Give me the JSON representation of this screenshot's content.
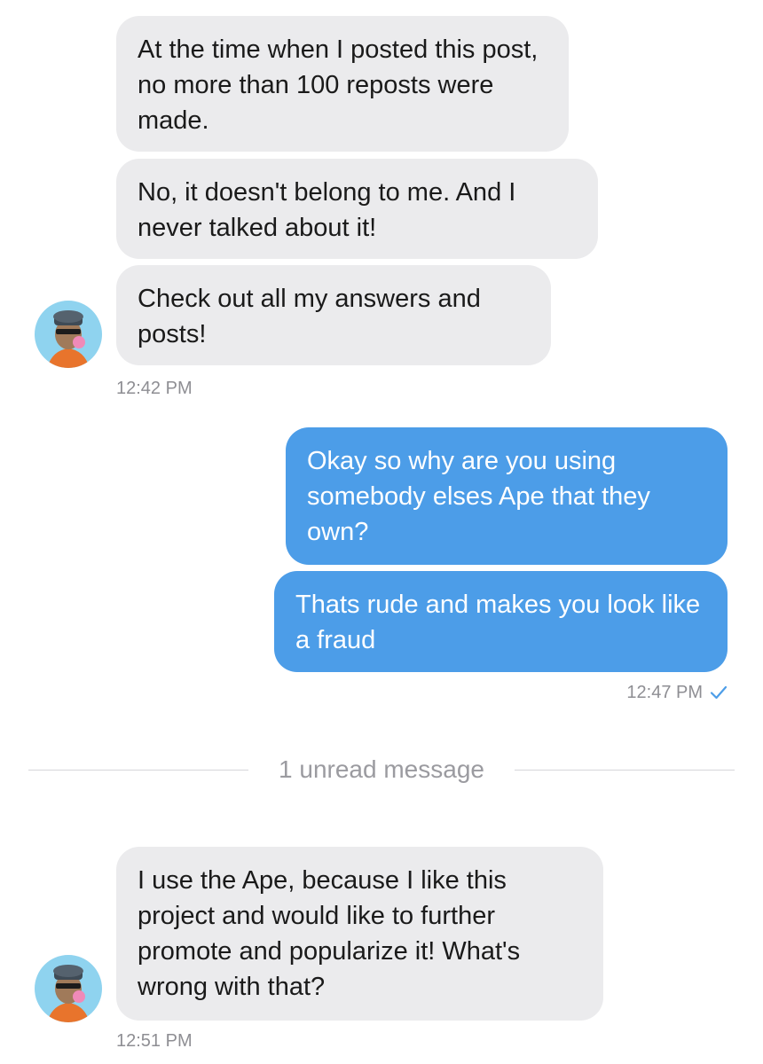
{
  "thread": {
    "first_group": {
      "messages": [
        "At the time when I posted this post, no more than 100 reposts were made.",
        "No, it doesn't belong to me. And I never talked about it!",
        "Check out all my answers and posts!"
      ],
      "time": "12:42 PM",
      "avatar": "ape-avatar-icon"
    },
    "my_group": {
      "messages": [
        "Okay so why are you using somebody elses Ape that they own?",
        "Thats rude and makes you look like a fraud"
      ],
      "time": "12:47 PM",
      "status_icon": "read-check-icon"
    },
    "unread_divider": "1 unread message",
    "last_group": {
      "messages": [
        "I use the Ape, because I like this project and would like to further promote and popularize it! What's wrong with that?"
      ],
      "time": "12:51 PM",
      "avatar": "ape-avatar-icon"
    }
  },
  "colors": {
    "incoming_bubble": "#ebebed",
    "outgoing_bubble": "#4c9de8",
    "timestamp": "#8e8e93",
    "check": "#4c9de8"
  }
}
